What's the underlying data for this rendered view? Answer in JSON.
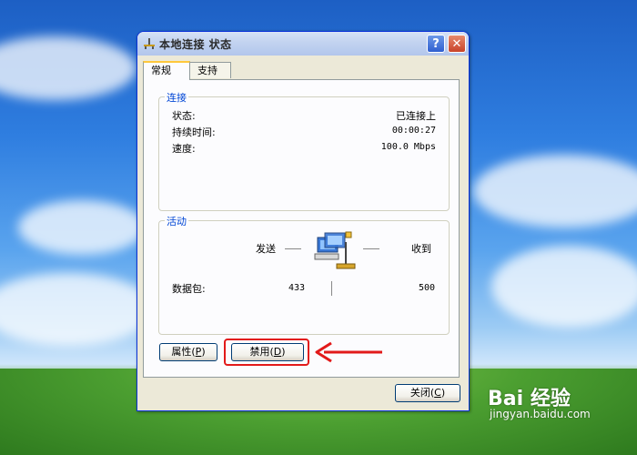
{
  "window": {
    "title": "本地连接 状态",
    "help_label": "?",
    "close_label": "✕"
  },
  "tabs": [
    {
      "label": "常规",
      "active": true
    },
    {
      "label": "支持",
      "active": false
    }
  ],
  "connection": {
    "legend": "连接",
    "rows": [
      {
        "label": "状态:",
        "value": "已连接上"
      },
      {
        "label": "持续时间:",
        "value": "00:00:27"
      },
      {
        "label": "速度:",
        "value": "100.0 Mbps"
      }
    ]
  },
  "activity": {
    "legend": "活动",
    "sent_label": "发送",
    "received_label": "收到",
    "packets_label": "数据包:",
    "packets_sent": "433",
    "packets_received": "500"
  },
  "buttons": {
    "properties_label": "属性",
    "properties_key": "P",
    "disable_label": "禁用",
    "disable_key": "D",
    "close_label": "关闭",
    "close_key": "C"
  },
  "watermark": {
    "brand": "Bai 经验",
    "url": "jingyan.baidu.com"
  },
  "colors": {
    "highlight": "#e21a1a",
    "legend_text": "#0046d5",
    "window_frame": "#0831d9"
  }
}
